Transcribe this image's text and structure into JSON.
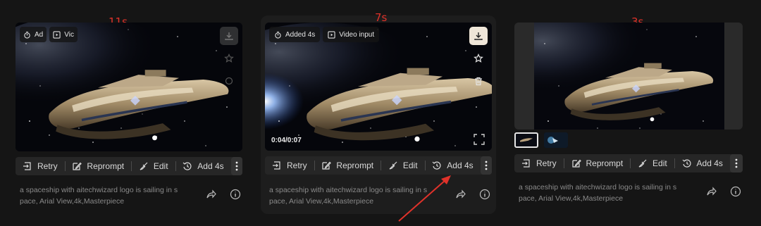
{
  "cards": [
    {
      "time_label": "11s",
      "chips": [
        {
          "label": "Ad",
          "icon": "timer-icon"
        },
        {
          "label": "Vic",
          "icon": "video-icon"
        }
      ],
      "toolbar": {
        "retry": "Retry",
        "reprompt": "Reprompt",
        "edit": "Edit",
        "add": "Add 4s"
      },
      "prompt": "a spaceship with aitechwizard logo is sailing in s pace, Arial View,4k,Masterpiece"
    },
    {
      "time_label": "7s",
      "chips": [
        {
          "label": "Added 4s",
          "icon": "timer-icon"
        },
        {
          "label": "Video input",
          "icon": "video-icon"
        }
      ],
      "time_readout": "0:04/0:07",
      "toolbar": {
        "retry": "Retry",
        "reprompt": "Reprompt",
        "edit": "Edit",
        "add": "Add 4s"
      },
      "prompt": "a spaceship with aitechwizard logo is sailing in s pace, Arial View,4k,Masterpiece"
    },
    {
      "time_label": "3s",
      "toolbar": {
        "retry": "Retry",
        "reprompt": "Reprompt",
        "edit": "Edit",
        "add": "Add 4s"
      },
      "prompt": "a spaceship with aitechwizard logo is sailing in s pace, Arial View,4k,Masterpiece"
    }
  ],
  "colors": {
    "annotation_red": "#e0322a",
    "download_bg": "#efe6d8",
    "toolbar_bg": "#262626",
    "page_bg": "#151515"
  }
}
